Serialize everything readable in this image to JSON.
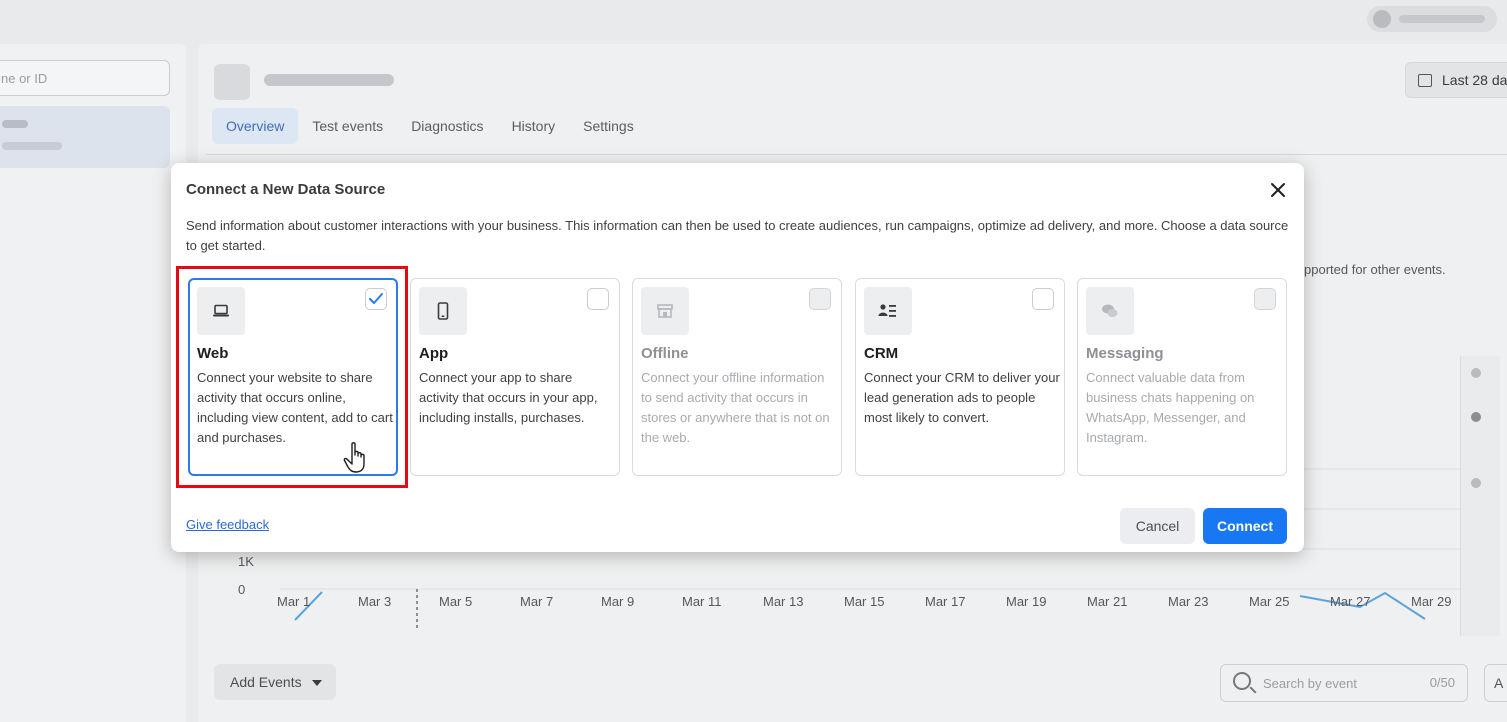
{
  "background": {
    "left_panel": {
      "search_placeholder": "ne or ID"
    },
    "header": {
      "date_range_label": "Last 28 da"
    },
    "tabs": [
      {
        "label": "Overview",
        "active": true
      },
      {
        "label": "Test events",
        "active": false
      },
      {
        "label": "Diagnostics",
        "active": false
      },
      {
        "label": "History",
        "active": false
      },
      {
        "label": "Settings",
        "active": false
      }
    ],
    "partial_text": "pported for other events.",
    "chart": {
      "y_ticks": [
        "1K",
        "0"
      ],
      "x_ticks": [
        "Mar 1",
        "Mar 3",
        "Mar 5",
        "Mar 7",
        "Mar 9",
        "Mar 11",
        "Mar 13",
        "Mar 15",
        "Mar 17",
        "Mar 19",
        "Mar 21",
        "Mar 23",
        "Mar 25",
        "Mar 27",
        "Mar 29"
      ]
    },
    "add_events_label": "Add Events",
    "search_event_placeholder": "Search by event",
    "search_event_count": "0/50",
    "far_right_button_label": "A"
  },
  "modal": {
    "title": "Connect a New Data Source",
    "description": "Send information about customer interactions with your business. This information can then be used to create audiences, run campaigns, optimize ad delivery, and more. Choose a data source to get started.",
    "sources": [
      {
        "name": "Web",
        "icon": "laptop-icon",
        "description": "Connect your website to share activity that occurs online, including view content, add to cart and purchases.",
        "selected": true,
        "disabled": false
      },
      {
        "name": "App",
        "icon": "phone-icon",
        "description": "Connect your app to share activity that occurs in your app, including installs, purchases.",
        "selected": false,
        "disabled": false
      },
      {
        "name": "Offline",
        "icon": "store-icon",
        "description": "Connect your offline information to send activity that occurs in stores or anywhere that is not on the web.",
        "selected": false,
        "disabled": true
      },
      {
        "name": "CRM",
        "icon": "people-list-icon",
        "description": "Connect your CRM to deliver your lead generation ads to people most likely to convert.",
        "selected": false,
        "disabled": false
      },
      {
        "name": "Messaging",
        "icon": "chat-bubbles-icon",
        "description": "Connect valuable data from business chats happening on WhatsApp, Messenger, and Instagram.",
        "selected": false,
        "disabled": true
      }
    ],
    "feedback_link": "Give feedback",
    "cancel_label": "Cancel",
    "connect_label": "Connect"
  },
  "colors": {
    "primary": "#1877f2",
    "selected_border": "#2d7be3",
    "highlight_annotation": "#e50914",
    "link": "#2d6ad6"
  }
}
